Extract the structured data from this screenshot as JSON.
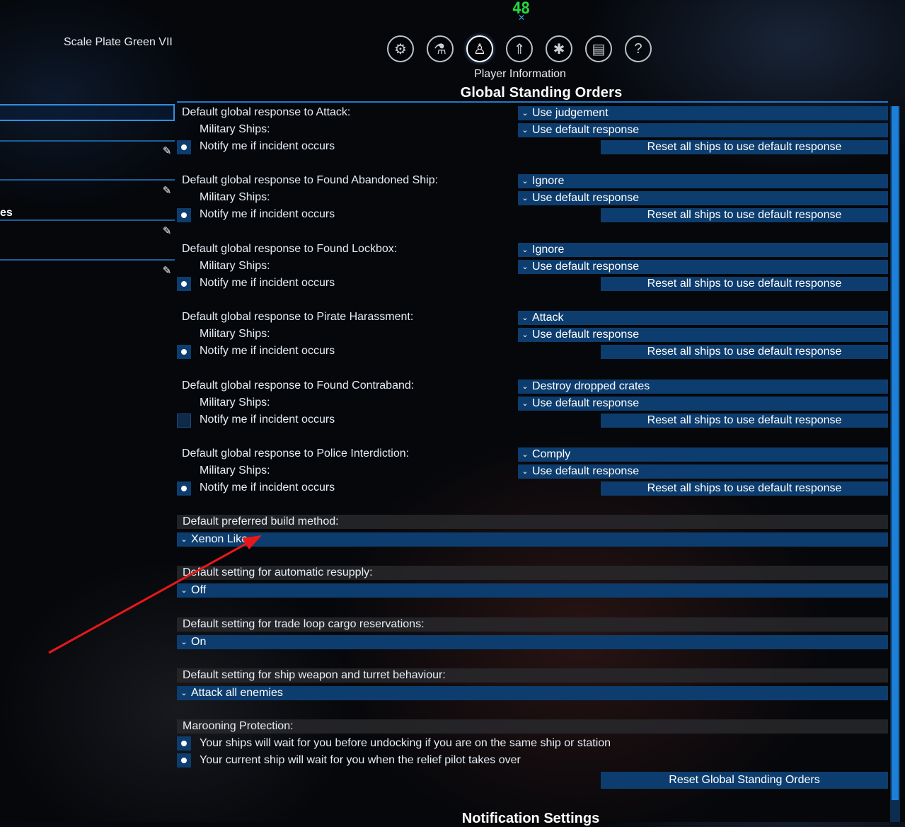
{
  "hud": {
    "fps": "48"
  },
  "ship_name": "Scale Plate Green VII",
  "menu": {
    "tabs": [
      {
        "icon": "gear-icon",
        "glyph": "⚙"
      },
      {
        "icon": "flask-icon",
        "glyph": "⚗"
      },
      {
        "icon": "person-icon",
        "glyph": "♙"
      },
      {
        "icon": "rocket-icon",
        "glyph": "⇑"
      },
      {
        "icon": "map-icon",
        "glyph": "✱"
      },
      {
        "icon": "book-icon",
        "glyph": "▤"
      },
      {
        "icon": "help-icon",
        "glyph": "?"
      }
    ],
    "active_tab": 2,
    "subtitle": "Player Information"
  },
  "page_title": "Global Standing Orders",
  "left_panel": {
    "partial_label": "es"
  },
  "responses": [
    {
      "label": "Default global response to Attack:",
      "value": "Use judgement",
      "military_label": "Military Ships:",
      "military_value": "Use default response",
      "notify_label": "Notify me if incident occurs",
      "notify_checked": true,
      "reset_label": "Reset all ships to use default response"
    },
    {
      "label": "Default global response to Found Abandoned Ship:",
      "value": "Ignore",
      "military_label": "Military Ships:",
      "military_value": "Use default response",
      "notify_label": "Notify me if incident occurs",
      "notify_checked": true,
      "reset_label": "Reset all ships to use default response"
    },
    {
      "label": "Default global response to Found Lockbox:",
      "value": "Ignore",
      "military_label": "Military Ships:",
      "military_value": "Use default response",
      "notify_label": "Notify me if incident occurs",
      "notify_checked": true,
      "reset_label": "Reset all ships to use default response"
    },
    {
      "label": "Default global response to Pirate Harassment:",
      "value": "Attack",
      "military_label": "Military Ships:",
      "military_value": "Use default response",
      "notify_label": "Notify me if incident occurs",
      "notify_checked": true,
      "reset_label": "Reset all ships to use default response"
    },
    {
      "label": "Default global response to Found Contraband:",
      "value": "Destroy dropped crates",
      "military_label": "Military Ships:",
      "military_value": "Use default response",
      "notify_label": "Notify me if incident occurs",
      "notify_checked": false,
      "reset_label": "Reset all ships to use default response"
    },
    {
      "label": "Default global response to Police Interdiction:",
      "value": "Comply",
      "military_label": "Military Ships:",
      "military_value": "Use default response",
      "notify_label": "Notify me if incident occurs",
      "notify_checked": true,
      "reset_label": "Reset all ships to use default response"
    }
  ],
  "settings": [
    {
      "label": "Default preferred build method:",
      "value": "Xenon Like"
    },
    {
      "label": "Default setting for automatic resupply:",
      "value": "Off"
    },
    {
      "label": "Default setting for trade loop cargo reservations:",
      "value": "On"
    },
    {
      "label": "Default setting for ship weapon and turret behaviour:",
      "value": "Attack all enemies"
    }
  ],
  "marooning": {
    "label": "Marooning Protection:",
    "options": [
      {
        "label": "Your ships will wait for you before undocking if you are on the same ship or station",
        "checked": true
      },
      {
        "label": "Your current ship will wait for you when the relief pilot takes over",
        "checked": true
      }
    ]
  },
  "reset_global_label": "Reset Global Standing Orders",
  "next_section_title": "Notification Settings",
  "colors": {
    "accent": "#1d7fd8",
    "panel": "#0d3d6e",
    "annotation_arrow": "#e81818",
    "fps": "#27d83a"
  }
}
